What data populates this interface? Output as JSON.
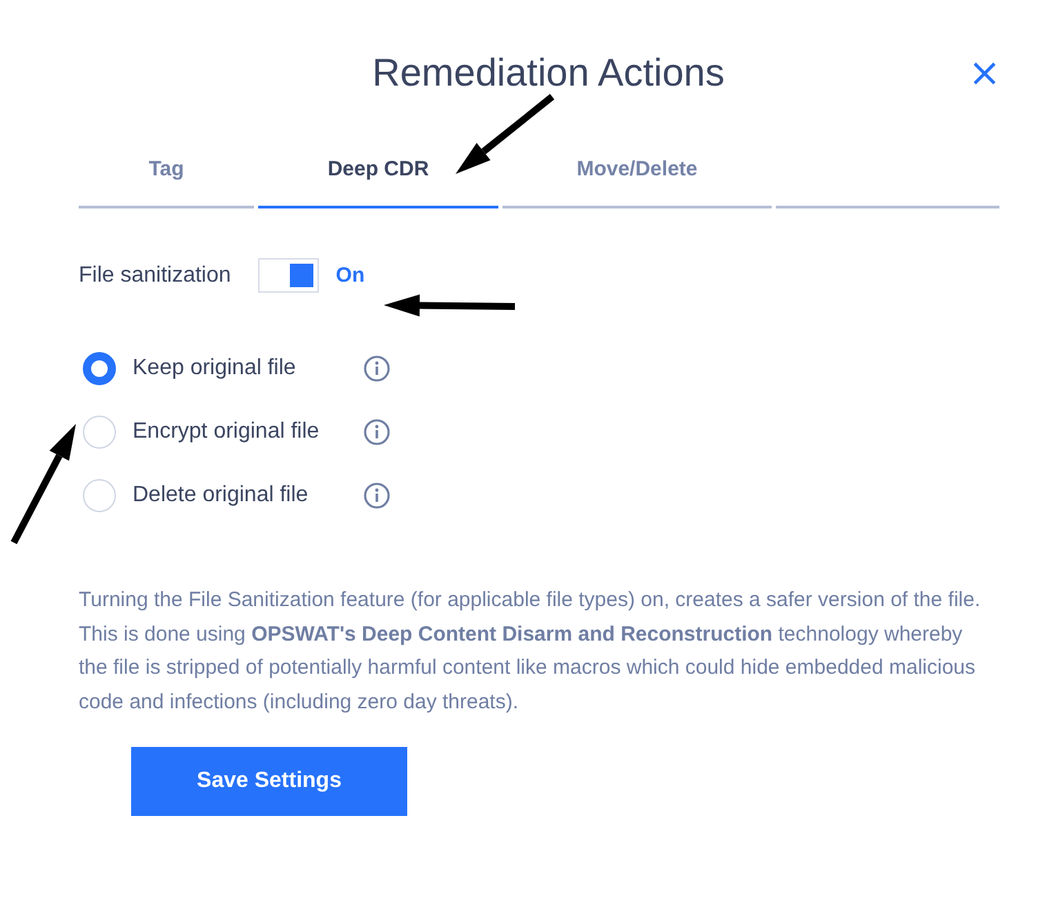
{
  "dialog": {
    "title": "Remediation Actions",
    "close": "×"
  },
  "tabs": [
    {
      "label": "Tag",
      "selected": false
    },
    {
      "label": "Deep CDR",
      "selected": true
    },
    {
      "label": "Move/Delete",
      "selected": false
    }
  ],
  "sanitization": {
    "label": "File sanitization",
    "on": true,
    "state_text": "On"
  },
  "options": [
    {
      "label": "Keep original file",
      "selected": true
    },
    {
      "label": "Encrypt original file",
      "selected": false
    },
    {
      "label": "Delete original file",
      "selected": false
    }
  ],
  "description": "Turning the File Sanitization feature (for applicable file types) on, creates a safer version of the file. This is done using **OPSWAT's Deep Content Disarm and Reconstruction** technology whereby the file is stripped of potentially harmful content like macros which could hide embedded malicious code and infections (including zero day threats).",
  "save_button": "Save Settings"
}
